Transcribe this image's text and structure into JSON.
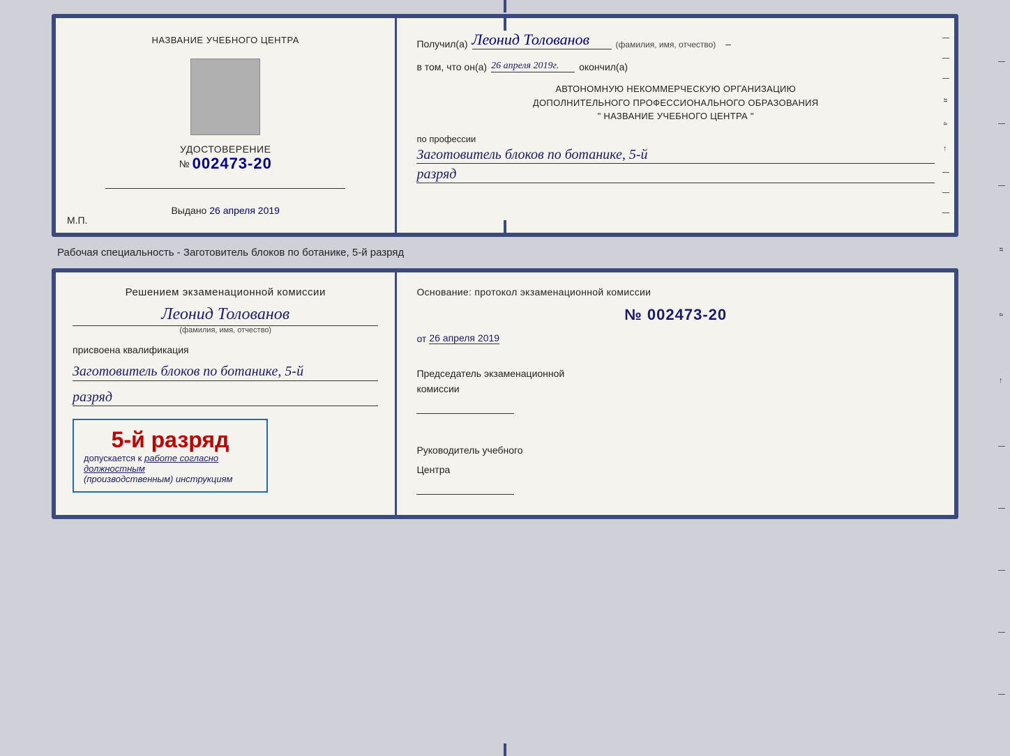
{
  "page": {
    "background": "#d0d0d8"
  },
  "top_card": {
    "left": {
      "center_title": "НАЗВАНИЕ УЧЕБНОГО ЦЕНТРА",
      "cert_label": "УДОСТОВЕРЕНИЕ",
      "cert_number_prefix": "№",
      "cert_number": "002473-20",
      "issued_label": "Выдано",
      "issued_date": "26 апреля 2019",
      "mp_label": "М.П."
    },
    "right": {
      "received_prefix": "Получил(а)",
      "recipient_name": "Леонид Толованов",
      "fio_subtitle": "(фамилия, имя, отчество)",
      "vtom_prefix": "в том, что он(а)",
      "vtom_date": "26 апреля 2019г.",
      "okончил_label": "окончил(а)",
      "org_line1": "АВТОНОМНУЮ НЕКОММЕРЧЕСКУЮ ОРГАНИЗАЦИЮ",
      "org_line2": "ДОПОЛНИТЕЛЬНОГО ПРОФЕССИОНАЛЬНОГО ОБРАЗОВАНИЯ",
      "org_line3": "\"  НАЗВАНИЕ УЧЕБНОГО ЦЕНТРА  \"",
      "profession_prefix": "по профессии",
      "profession_value": "Заготовитель блоков по ботанике, 5-й",
      "razryad_value": "разряд"
    }
  },
  "specialty_line": "Рабочая специальность - Заготовитель блоков по ботанике, 5-й разряд",
  "bottom_card": {
    "left": {
      "decision_title": "Решением экзаменационной комиссии",
      "person_name": "Леонид Толованов",
      "fio_subtitle": "(фамилия, имя, отчество)",
      "assigned_label": "присвоена квалификация",
      "qual_value": "Заготовитель блоков по ботанике, 5-й",
      "razryad_value": "разряд",
      "stamp_grade": "5-й разряд",
      "stamp_allowed_prefix": "допускается к",
      "stamp_allowed_text": " работе согласно должностным",
      "stamp_italic": "(производственным) инструкциям"
    },
    "right": {
      "osnование_label": "Основание: протокол экзаменационной комиссии",
      "protocol_number": "№  002473-20",
      "from_prefix": "от",
      "from_date": "26 апреля 2019",
      "commission_head_label": "Председатель экзаменационной",
      "commission_head_label2": "комиссии",
      "center_head_label": "Руководитель учебного",
      "center_head_label2": "Центра"
    }
  },
  "edge_letters": {
    "и": "и",
    "а": "а",
    "left_arrow": "←"
  }
}
